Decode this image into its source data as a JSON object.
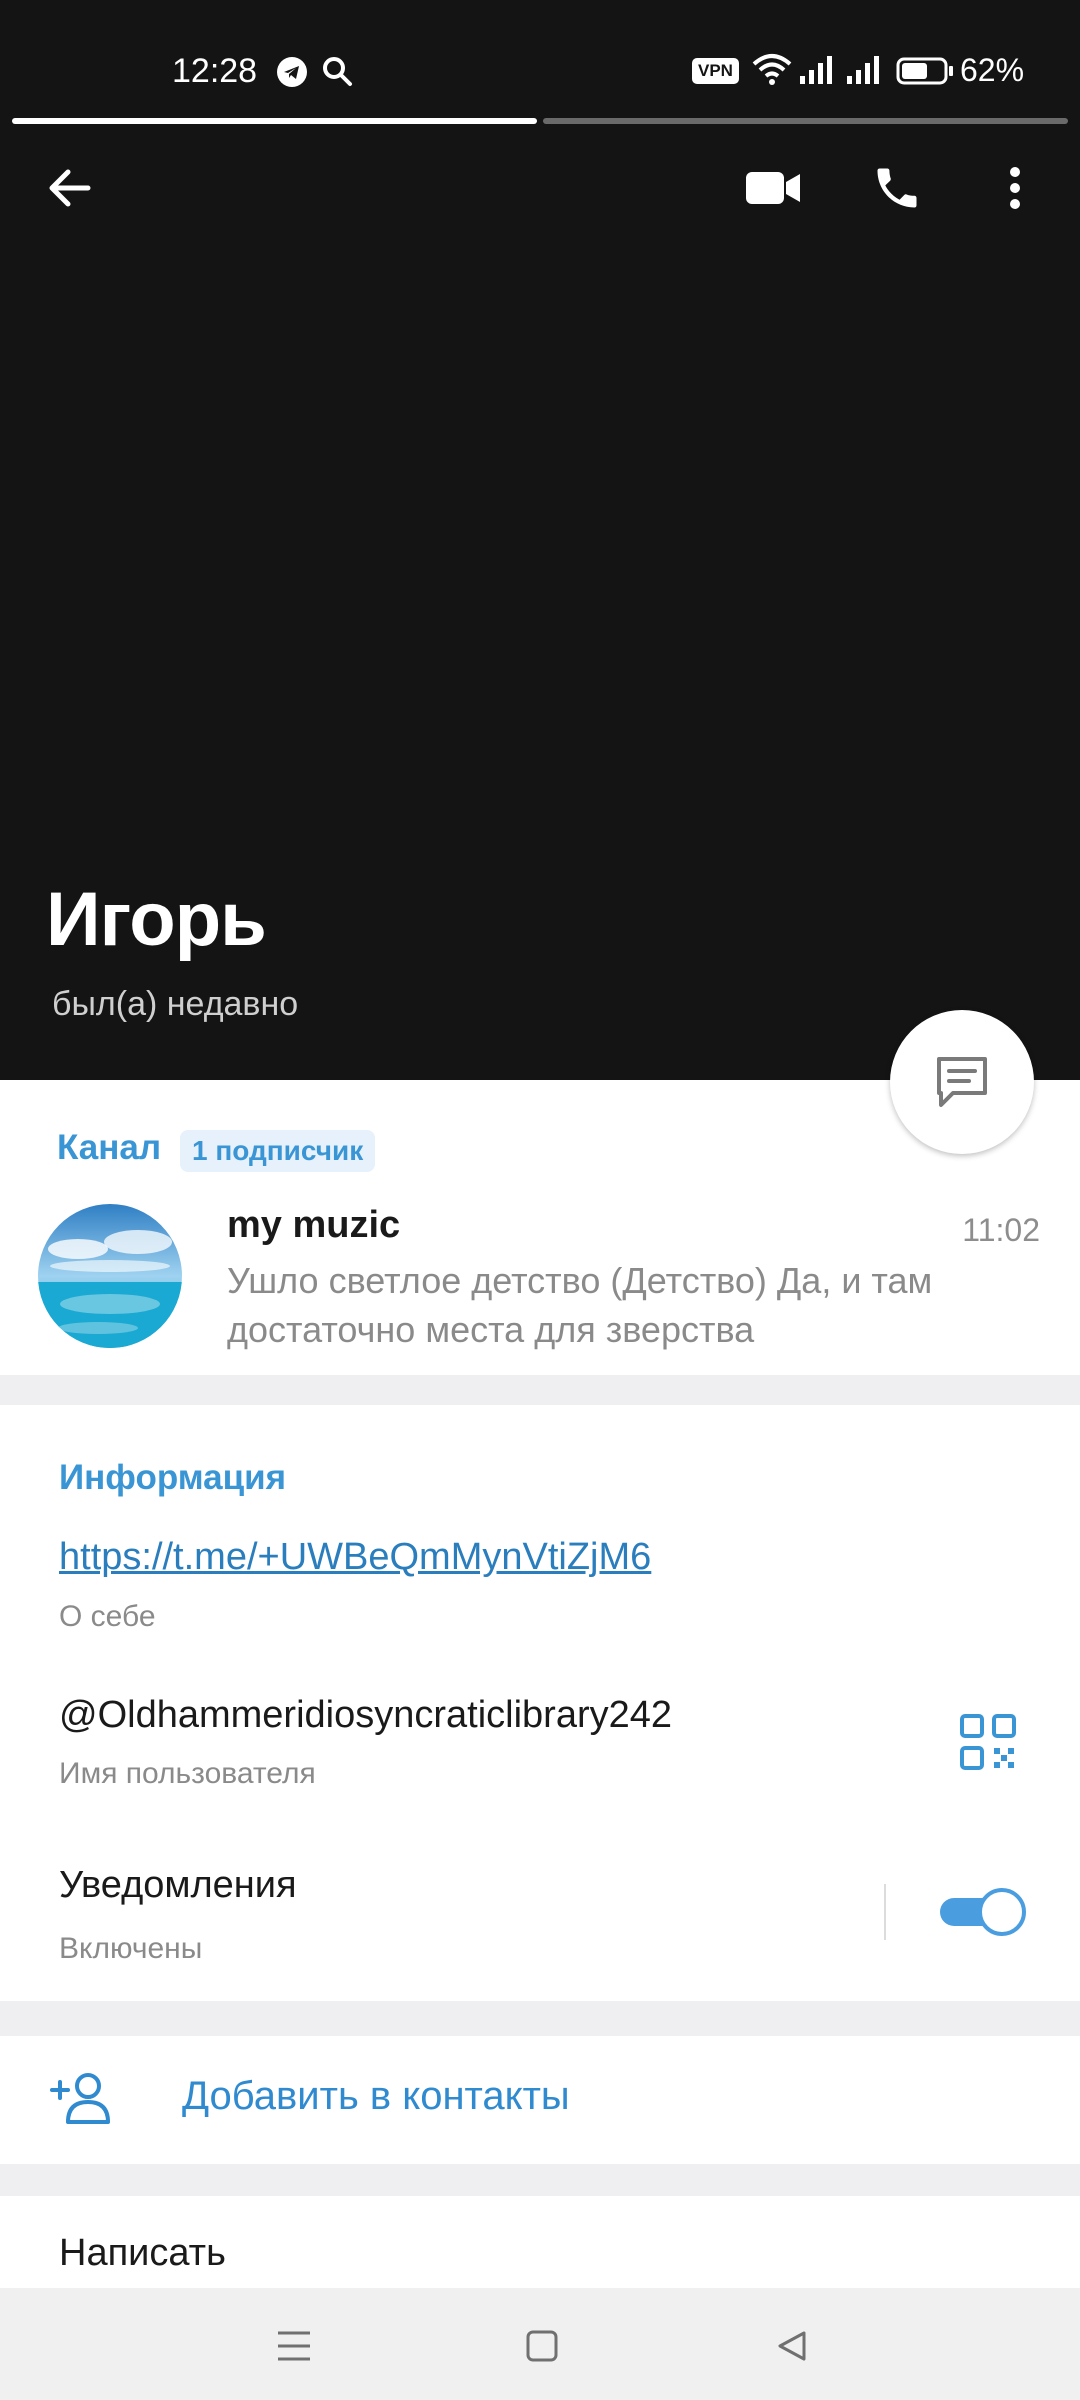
{
  "status_bar": {
    "time": "12:28",
    "vpn_label": "VPN",
    "battery_percent": "62%",
    "battery_level": 0.62
  },
  "story_progress": {
    "segments": 2,
    "active_segment": 1
  },
  "header": {
    "name": "Игорь",
    "status": "был(а) недавно",
    "icons": [
      "back-arrow-icon",
      "video-camera-icon",
      "phone-icon",
      "more-vert-icon",
      "message-icon"
    ]
  },
  "channel": {
    "label": "Канал",
    "subscribers": "1 подписчик",
    "name": "my muzic",
    "time": "11:02",
    "message": "Ушло светлое детство (Детство) Да, и там достаточно места для зверства"
  },
  "info": {
    "title": "Информация",
    "link": "https://t.me/+UWBeQmMynVtiZjM6",
    "link_caption": "О себе",
    "username": "@Oldhammeridiosyncraticlibrary242",
    "username_caption": "Имя пользователя",
    "notifications_label": "Уведомления",
    "notifications_state": "Включены",
    "notifications_enabled": true
  },
  "actions": {
    "add_contact": "Добавить в контакты",
    "write": "Написать"
  },
  "colors": {
    "header_bg": "#141414",
    "accent": "#3a95d5",
    "link": "#2a7ebd",
    "toggle_on": "#4a9ee0"
  }
}
